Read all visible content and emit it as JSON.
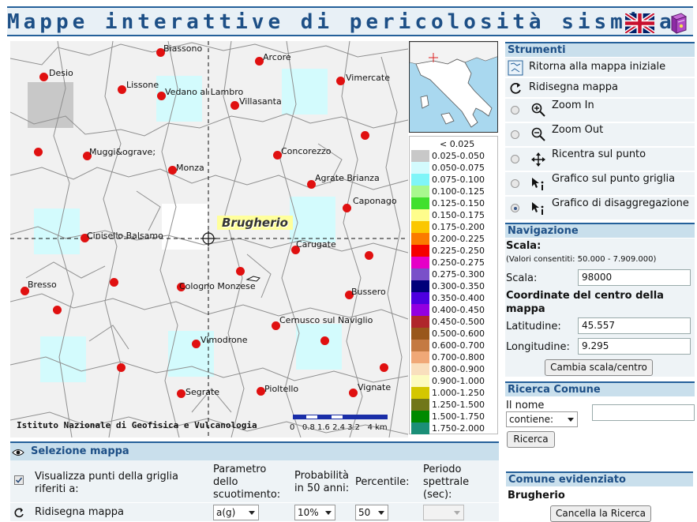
{
  "header": {
    "title": "Mappe interattive di pericolosità sismica",
    "flag_icon": "uk-flag-icon",
    "help_icon": "book-icon"
  },
  "map": {
    "highlight": "Brugherio",
    "credit": "Istituto Nazionale di Geofisica e Vulcanologia",
    "scale_labels": "0   0.8 1.6 2.4 3.2   4 km",
    "places": [
      "Biassono",
      "Arcore",
      "Desio",
      "Lissone",
      "Vedano al Lambro",
      "Vimercate",
      "Villasanta",
      "Muggi&ograve;",
      "Concorezzo",
      "Monza",
      "Agrate Brianza",
      "Caponago",
      "Cinisello Balsamo",
      "Carugate",
      "Bresso",
      "Cologno Monzese",
      "Bussero",
      "Cernusco sul Naviglio",
      "Vimodrone",
      "Vignate",
      "Segrate",
      "Pioltello"
    ]
  },
  "legend": {
    "items": [
      {
        "label": "< 0.025",
        "color": "#ffffff"
      },
      {
        "label": "0.025-0.050",
        "color": "#c8c8c8"
      },
      {
        "label": "0.050-0.075",
        "color": "#d3fbfd"
      },
      {
        "label": "0.075-0.100",
        "color": "#7ff5f8"
      },
      {
        "label": "0.100-0.125",
        "color": "#a8f88e"
      },
      {
        "label": "0.125-0.150",
        "color": "#41e02e"
      },
      {
        "label": "0.150-0.175",
        "color": "#fefd8c"
      },
      {
        "label": "0.175-0.200",
        "color": "#fbc700"
      },
      {
        "label": "0.200-0.225",
        "color": "#fb7b00"
      },
      {
        "label": "0.225-0.250",
        "color": "#f50000"
      },
      {
        "label": "0.250-0.275",
        "color": "#e600c7"
      },
      {
        "label": "0.275-0.300",
        "color": "#7a50c9"
      },
      {
        "label": "0.300-0.350",
        "color": "#00007a"
      },
      {
        "label": "0.350-0.400",
        "color": "#4d00e0"
      },
      {
        "label": "0.400-0.450",
        "color": "#9300e0"
      },
      {
        "label": "0.450-0.500",
        "color": "#b0262b"
      },
      {
        "label": "0.500-0.600",
        "color": "#99571b"
      },
      {
        "label": "0.600-0.700",
        "color": "#c47a42"
      },
      {
        "label": "0.700-0.800",
        "color": "#f0a877"
      },
      {
        "label": "0.800-0.900",
        "color": "#f9dfbd"
      },
      {
        "label": "0.900-1.000",
        "color": "#fcfbc0"
      },
      {
        "label": "1.000-1.250",
        "color": "#d4c700"
      },
      {
        "label": "1.250-1.500",
        "color": "#71771a"
      },
      {
        "label": "1.500-1.750",
        "color": "#008a00"
      },
      {
        "label": "1.750-2.000",
        "color": "#1b8f78"
      }
    ]
  },
  "tools": {
    "title": "Strumenti",
    "reset": "Ritorna alla mappa iniziale",
    "redraw": "Ridisegna mappa",
    "zoom_in": "Zoom In",
    "zoom_out": "Zoom Out",
    "recenter": "Ricentra sul punto",
    "grid_chart": "Grafico sul punto griglia",
    "disagg_chart": "Grafico di disaggregazione",
    "selected": "disagg_chart"
  },
  "navigation": {
    "title": "Navigazione",
    "scale_heading": "Scala:",
    "scale_range": "(Valori consentiti: 50.000 - 7.909.000)",
    "scale_label": "Scala:",
    "scale_value": "98000",
    "coord_heading": "Coordinate del centro della mappa",
    "lat_label": "Latitudine:",
    "lat_value": "45.557",
    "lon_label": "Longitudine:",
    "lon_value": "9.295",
    "apply_button": "Cambia scala/centro"
  },
  "search": {
    "title": "Ricerca Comune",
    "name_label": "Il nome",
    "mode": "contiene:",
    "query": "",
    "button": "Ricerca"
  },
  "highlighted": {
    "title": "Comune evidenziato",
    "name": "Brugherio",
    "clear_button": "Cancella la Ricerca"
  },
  "selection": {
    "title": "Selezione mappa",
    "show_points": "Visualizza punti della griglia riferiti a:",
    "show_points_checked": true,
    "redraw": "Ridisegna mappa",
    "param_label": "Parametro dello scuotimento:",
    "param_value": "a(g)",
    "prob_label": "Probabilità in 50 anni:",
    "prob_value": "10%",
    "pct_label": "Percentile:",
    "pct_value": "50",
    "period_label": "Periodo spettrale (sec):",
    "period_value": ""
  }
}
